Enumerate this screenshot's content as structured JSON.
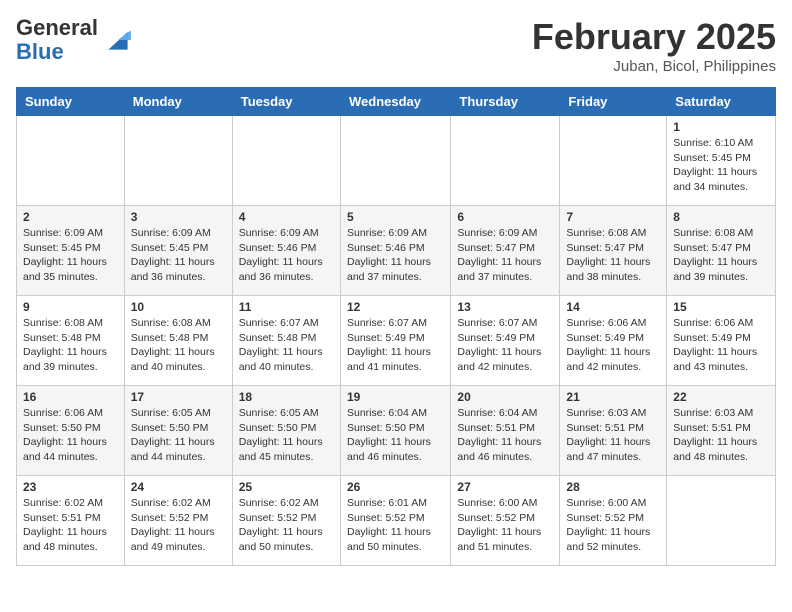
{
  "header": {
    "logo_general": "General",
    "logo_blue": "Blue",
    "month_title": "February 2025",
    "location": "Juban, Bicol, Philippines"
  },
  "days_of_week": [
    "Sunday",
    "Monday",
    "Tuesday",
    "Wednesday",
    "Thursday",
    "Friday",
    "Saturday"
  ],
  "weeks": [
    [
      {
        "day": "",
        "info": ""
      },
      {
        "day": "",
        "info": ""
      },
      {
        "day": "",
        "info": ""
      },
      {
        "day": "",
        "info": ""
      },
      {
        "day": "",
        "info": ""
      },
      {
        "day": "",
        "info": ""
      },
      {
        "day": "1",
        "info": "Sunrise: 6:10 AM\nSunset: 5:45 PM\nDaylight: 11 hours and 34 minutes."
      }
    ],
    [
      {
        "day": "2",
        "info": "Sunrise: 6:09 AM\nSunset: 5:45 PM\nDaylight: 11 hours and 35 minutes."
      },
      {
        "day": "3",
        "info": "Sunrise: 6:09 AM\nSunset: 5:45 PM\nDaylight: 11 hours and 36 minutes."
      },
      {
        "day": "4",
        "info": "Sunrise: 6:09 AM\nSunset: 5:46 PM\nDaylight: 11 hours and 36 minutes."
      },
      {
        "day": "5",
        "info": "Sunrise: 6:09 AM\nSunset: 5:46 PM\nDaylight: 11 hours and 37 minutes."
      },
      {
        "day": "6",
        "info": "Sunrise: 6:09 AM\nSunset: 5:47 PM\nDaylight: 11 hours and 37 minutes."
      },
      {
        "day": "7",
        "info": "Sunrise: 6:08 AM\nSunset: 5:47 PM\nDaylight: 11 hours and 38 minutes."
      },
      {
        "day": "8",
        "info": "Sunrise: 6:08 AM\nSunset: 5:47 PM\nDaylight: 11 hours and 39 minutes."
      }
    ],
    [
      {
        "day": "9",
        "info": "Sunrise: 6:08 AM\nSunset: 5:48 PM\nDaylight: 11 hours and 39 minutes."
      },
      {
        "day": "10",
        "info": "Sunrise: 6:08 AM\nSunset: 5:48 PM\nDaylight: 11 hours and 40 minutes."
      },
      {
        "day": "11",
        "info": "Sunrise: 6:07 AM\nSunset: 5:48 PM\nDaylight: 11 hours and 40 minutes."
      },
      {
        "day": "12",
        "info": "Sunrise: 6:07 AM\nSunset: 5:49 PM\nDaylight: 11 hours and 41 minutes."
      },
      {
        "day": "13",
        "info": "Sunrise: 6:07 AM\nSunset: 5:49 PM\nDaylight: 11 hours and 42 minutes."
      },
      {
        "day": "14",
        "info": "Sunrise: 6:06 AM\nSunset: 5:49 PM\nDaylight: 11 hours and 42 minutes."
      },
      {
        "day": "15",
        "info": "Sunrise: 6:06 AM\nSunset: 5:49 PM\nDaylight: 11 hours and 43 minutes."
      }
    ],
    [
      {
        "day": "16",
        "info": "Sunrise: 6:06 AM\nSunset: 5:50 PM\nDaylight: 11 hours and 44 minutes."
      },
      {
        "day": "17",
        "info": "Sunrise: 6:05 AM\nSunset: 5:50 PM\nDaylight: 11 hours and 44 minutes."
      },
      {
        "day": "18",
        "info": "Sunrise: 6:05 AM\nSunset: 5:50 PM\nDaylight: 11 hours and 45 minutes."
      },
      {
        "day": "19",
        "info": "Sunrise: 6:04 AM\nSunset: 5:50 PM\nDaylight: 11 hours and 46 minutes."
      },
      {
        "day": "20",
        "info": "Sunrise: 6:04 AM\nSunset: 5:51 PM\nDaylight: 11 hours and 46 minutes."
      },
      {
        "day": "21",
        "info": "Sunrise: 6:03 AM\nSunset: 5:51 PM\nDaylight: 11 hours and 47 minutes."
      },
      {
        "day": "22",
        "info": "Sunrise: 6:03 AM\nSunset: 5:51 PM\nDaylight: 11 hours and 48 minutes."
      }
    ],
    [
      {
        "day": "23",
        "info": "Sunrise: 6:02 AM\nSunset: 5:51 PM\nDaylight: 11 hours and 48 minutes."
      },
      {
        "day": "24",
        "info": "Sunrise: 6:02 AM\nSunset: 5:52 PM\nDaylight: 11 hours and 49 minutes."
      },
      {
        "day": "25",
        "info": "Sunrise: 6:02 AM\nSunset: 5:52 PM\nDaylight: 11 hours and 50 minutes."
      },
      {
        "day": "26",
        "info": "Sunrise: 6:01 AM\nSunset: 5:52 PM\nDaylight: 11 hours and 50 minutes."
      },
      {
        "day": "27",
        "info": "Sunrise: 6:00 AM\nSunset: 5:52 PM\nDaylight: 11 hours and 51 minutes."
      },
      {
        "day": "28",
        "info": "Sunrise: 6:00 AM\nSunset: 5:52 PM\nDaylight: 11 hours and 52 minutes."
      },
      {
        "day": "",
        "info": ""
      }
    ]
  ]
}
